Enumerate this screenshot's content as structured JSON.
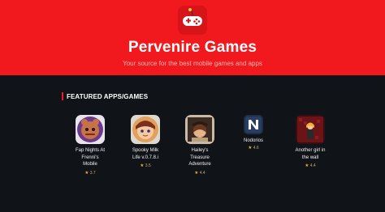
{
  "site": {
    "title": "Pervenire Games",
    "tagline": "Your source for the best mobile games and apps",
    "logo_icon": "gamepad-icon"
  },
  "colors": {
    "brand_red": "#f1191d",
    "background": "#101318",
    "star": "#e7b43a"
  },
  "featured": {
    "heading": "FEATURED APPS/GAMES",
    "apps": [
      {
        "name_lines": [
          "Fap Nights At",
          "Frenni's",
          "Mobile"
        ],
        "rating": "3.7",
        "icon": "fap-nights-app-icon"
      },
      {
        "name_lines": [
          "Spooky Milk",
          "Life v.0.7.8.i"
        ],
        "rating": "3.5",
        "icon": "spooky-milk-life-app-icon"
      },
      {
        "name_lines": [
          "Hailey's",
          "Treasure",
          "Adventure"
        ],
        "rating": "4.4",
        "icon": "haileys-treasure-app-icon"
      },
      {
        "name_lines": [
          "Nodorios"
        ],
        "rating": "4.6",
        "icon": "nodorios-app-icon"
      },
      {
        "name_lines": [
          "Another girl in",
          "the wall"
        ],
        "rating": "4.4",
        "icon": "another-girl-app-icon"
      }
    ]
  }
}
